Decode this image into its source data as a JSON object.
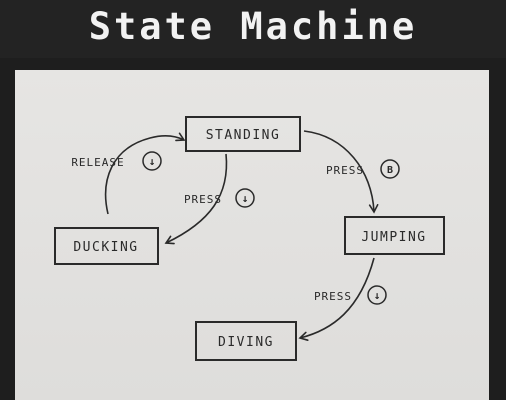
{
  "title": "State Machine",
  "states": {
    "standing": "STANDING",
    "jumping": "JUMPING",
    "ducking": "DUCKING",
    "diving": "DIVING"
  },
  "transitions": {
    "release_down": {
      "label": "RELEASE",
      "button": "↓"
    },
    "press_down_duck": {
      "label": "PRESS",
      "button": "↓"
    },
    "press_b": {
      "label": "PRESS",
      "button": "B"
    },
    "press_down_dive": {
      "label": "PRESS",
      "button": "↓"
    }
  },
  "colors": {
    "paper": "#e4e3e1",
    "ink": "#2a2a2a",
    "title": "#f2f2f2",
    "background": "#262626"
  }
}
